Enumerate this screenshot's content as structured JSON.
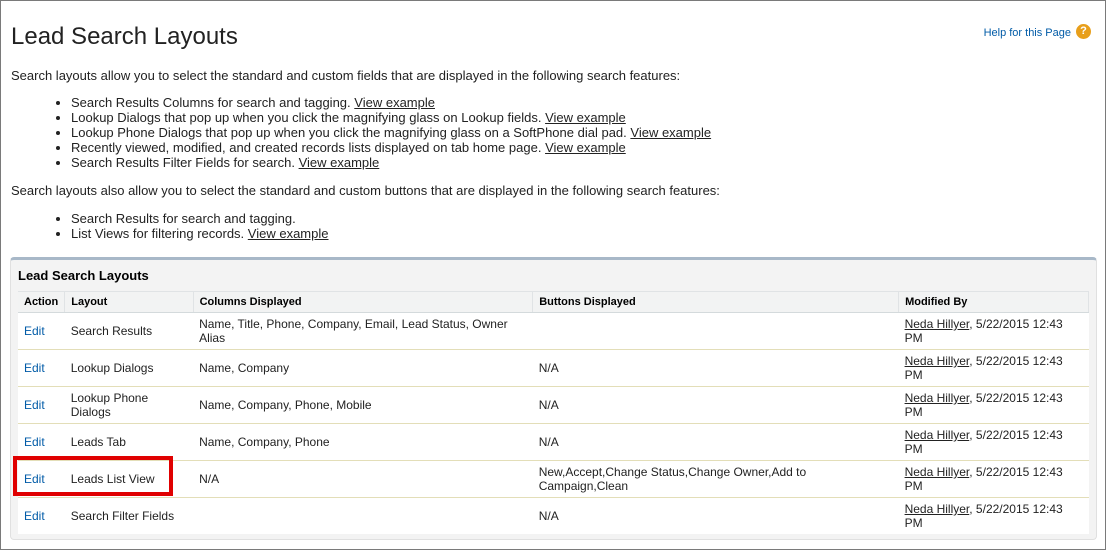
{
  "header": {
    "title": "Lead Search Layouts",
    "help_link": "Help for this Page",
    "help_icon": "?"
  },
  "intro": {
    "fields_text": "Search layouts allow you to select the standard and custom fields that are displayed in the following search features:",
    "field_items": [
      {
        "text": "Search Results Columns for search and tagging.",
        "link": "View example"
      },
      {
        "text": "Lookup Dialogs that pop up when you click the magnifying glass on Lookup fields.",
        "link": "View example"
      },
      {
        "text": "Lookup Phone Dialogs that pop up when you click the magnifying glass on a SoftPhone dial pad.",
        "link": "View example"
      },
      {
        "text": "Recently viewed, modified, and created records lists displayed on tab home page.",
        "link": "View example"
      },
      {
        "text": "Search Results Filter Fields for search.",
        "link": "View example"
      }
    ],
    "buttons_text": "Search layouts also allow you to select the standard and custom buttons that are displayed in the following search features:",
    "button_items": [
      {
        "text": "Search Results for search and tagging.",
        "link": ""
      },
      {
        "text": "List Views for filtering records.",
        "link": "View example"
      }
    ]
  },
  "panel": {
    "title": "Lead Search Layouts",
    "columns": [
      "Action",
      "Layout",
      "Columns Displayed",
      "Buttons Displayed",
      "Modified By"
    ],
    "rows": [
      {
        "action": "Edit",
        "layout": "Search Results",
        "columns": "Name, Title, Phone, Company, Email, Lead Status, Owner Alias",
        "buttons": "",
        "modified_by": "Neda Hillyer",
        "modified_date": ", 5/22/2015 12:43 PM"
      },
      {
        "action": "Edit",
        "layout": "Lookup Dialogs",
        "columns": "Name, Company",
        "buttons": "N/A",
        "modified_by": "Neda Hillyer",
        "modified_date": ", 5/22/2015 12:43 PM"
      },
      {
        "action": "Edit",
        "layout": "Lookup Phone Dialogs",
        "columns": "Name, Company, Phone, Mobile",
        "buttons": "N/A",
        "modified_by": "Neda Hillyer",
        "modified_date": ", 5/22/2015 12:43 PM"
      },
      {
        "action": "Edit",
        "layout": "Leads Tab",
        "columns": "Name, Company, Phone",
        "buttons": "N/A",
        "modified_by": "Neda Hillyer",
        "modified_date": ", 5/22/2015 12:43 PM"
      },
      {
        "action": "Edit",
        "layout": "Leads List View",
        "columns": "N/A",
        "buttons": "New,Accept,Change Status,Change Owner,Add to Campaign,Clean",
        "modified_by": "Neda Hillyer",
        "modified_date": ", 5/22/2015 12:43 PM"
      },
      {
        "action": "Edit",
        "layout": "Search Filter Fields",
        "columns": "",
        "buttons": "N/A",
        "modified_by": "Neda Hillyer",
        "modified_date": ", 5/22/2015 12:43 PM"
      }
    ]
  },
  "colors": {
    "link_blue": "#015ba7",
    "help_orange": "#e89f1b",
    "highlight_red": "#e00000",
    "panel_accent": "#a8b8c8"
  }
}
